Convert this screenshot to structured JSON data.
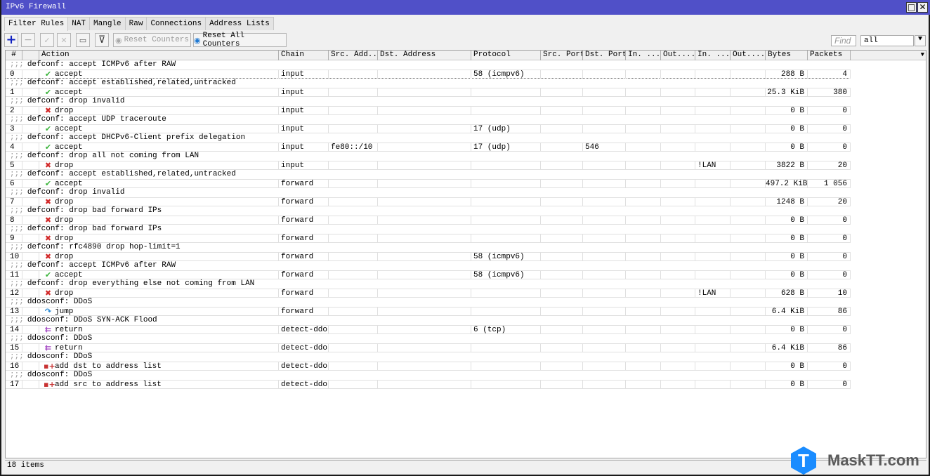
{
  "window": {
    "title": "IPv6 Firewall",
    "maximize_icon": "□",
    "close_icon": "✕"
  },
  "tabs": [
    {
      "label": "Filter Rules",
      "active": true
    },
    {
      "label": "NAT",
      "active": false
    },
    {
      "label": "Mangle",
      "active": false
    },
    {
      "label": "Raw",
      "active": false
    },
    {
      "label": "Connections",
      "active": false
    },
    {
      "label": "Address Lists",
      "active": false
    }
  ],
  "toolbar": {
    "add_icon": "+",
    "remove_icon": "−",
    "enable_icon": "✓",
    "disable_icon": "✕",
    "comment_icon": "▭",
    "filter_icon": "⊽",
    "reset_counters_label": "Reset Counters",
    "reset_all_counters_label": "Reset All Counters",
    "find_placeholder": "Find",
    "filter_value": "all",
    "filter_drop_icon": "⯆"
  },
  "table": {
    "columns": [
      "#",
      "",
      "Action",
      "Chain",
      "Src. Add...",
      "Dst. Address",
      "Protocol",
      "Src. Port",
      "Dst. Port",
      "In. ...",
      "Out....",
      "In. ...",
      "Out....",
      "Bytes",
      "Packets"
    ],
    "menu_icon": "▼",
    "rules": [
      {
        "comment": "defconf: accept ICMPv6 after RAW",
        "num": "0",
        "action": "accept",
        "action_type": "accept",
        "chain": "input",
        "src": "",
        "dst": "",
        "protocol": "58 (icmpv6)",
        "src_port": "",
        "dst_port": "",
        "in_iface": "",
        "out_iface": "",
        "in_list": "",
        "out_list": "",
        "bytes": "288 B",
        "packets": "4"
      },
      {
        "comment": "defconf: accept established,related,untracked",
        "num": "1",
        "action": "accept",
        "action_type": "accept",
        "chain": "input",
        "src": "",
        "dst": "",
        "protocol": "",
        "src_port": "",
        "dst_port": "",
        "in_iface": "",
        "out_iface": "",
        "in_list": "",
        "out_list": "",
        "bytes": "25.3 KiB",
        "packets": "380"
      },
      {
        "comment": "defconf: drop invalid",
        "num": "2",
        "action": "drop",
        "action_type": "drop",
        "chain": "input",
        "src": "",
        "dst": "",
        "protocol": "",
        "src_port": "",
        "dst_port": "",
        "in_iface": "",
        "out_iface": "",
        "in_list": "",
        "out_list": "",
        "bytes": "0 B",
        "packets": "0"
      },
      {
        "comment": "defconf: accept UDP traceroute",
        "num": "3",
        "action": "accept",
        "action_type": "accept",
        "chain": "input",
        "src": "",
        "dst": "",
        "protocol": "17 (udp)",
        "src_port": "",
        "dst_port": "",
        "in_iface": "",
        "out_iface": "",
        "in_list": "",
        "out_list": "",
        "bytes": "0 B",
        "packets": "0"
      },
      {
        "comment": "defconf: accept DHCPv6-Client prefix delegation",
        "num": "4",
        "action": "accept",
        "action_type": "accept",
        "chain": "input",
        "src": "fe80::/10",
        "dst": "",
        "protocol": "17 (udp)",
        "src_port": "",
        "dst_port": "546",
        "in_iface": "",
        "out_iface": "",
        "in_list": "",
        "out_list": "",
        "bytes": "0 B",
        "packets": "0"
      },
      {
        "comment": "defconf: drop all not coming from LAN",
        "num": "5",
        "action": "drop",
        "action_type": "drop",
        "chain": "input",
        "src": "",
        "dst": "",
        "protocol": "",
        "src_port": "",
        "dst_port": "",
        "in_iface": "",
        "out_iface": "",
        "in_list": "!LAN",
        "out_list": "",
        "bytes": "3822 B",
        "packets": "20"
      },
      {
        "comment": "defconf: accept established,related,untracked",
        "num": "6",
        "action": "accept",
        "action_type": "accept",
        "chain": "forward",
        "src": "",
        "dst": "",
        "protocol": "",
        "src_port": "",
        "dst_port": "",
        "in_iface": "",
        "out_iface": "",
        "in_list": "",
        "out_list": "",
        "bytes": "497.2 KiB",
        "packets": "1 056"
      },
      {
        "comment": "defconf: drop invalid",
        "num": "7",
        "action": "drop",
        "action_type": "drop",
        "chain": "forward",
        "src": "",
        "dst": "",
        "protocol": "",
        "src_port": "",
        "dst_port": "",
        "in_iface": "",
        "out_iface": "",
        "in_list": "",
        "out_list": "",
        "bytes": "1248 B",
        "packets": "20"
      },
      {
        "comment": "defconf: drop bad forward IPs",
        "num": "8",
        "action": "drop",
        "action_type": "drop",
        "chain": "forward",
        "src": "",
        "dst": "",
        "protocol": "",
        "src_port": "",
        "dst_port": "",
        "in_iface": "",
        "out_iface": "",
        "in_list": "",
        "out_list": "",
        "bytes": "0 B",
        "packets": "0"
      },
      {
        "comment": "defconf: drop bad forward IPs",
        "num": "9",
        "action": "drop",
        "action_type": "drop",
        "chain": "forward",
        "src": "",
        "dst": "",
        "protocol": "",
        "src_port": "",
        "dst_port": "",
        "in_iface": "",
        "out_iface": "",
        "in_list": "",
        "out_list": "",
        "bytes": "0 B",
        "packets": "0"
      },
      {
        "comment": "defconf: rfc4890 drop hop-limit=1",
        "num": "10",
        "action": "drop",
        "action_type": "drop",
        "chain": "forward",
        "src": "",
        "dst": "",
        "protocol": "58 (icmpv6)",
        "src_port": "",
        "dst_port": "",
        "in_iface": "",
        "out_iface": "",
        "in_list": "",
        "out_list": "",
        "bytes": "0 B",
        "packets": "0"
      },
      {
        "comment": "defconf: accept ICMPv6 after RAW",
        "num": "11",
        "action": "accept",
        "action_type": "accept",
        "chain": "forward",
        "src": "",
        "dst": "",
        "protocol": "58 (icmpv6)",
        "src_port": "",
        "dst_port": "",
        "in_iface": "",
        "out_iface": "",
        "in_list": "",
        "out_list": "",
        "bytes": "0 B",
        "packets": "0"
      },
      {
        "comment": "defconf: drop everything else not coming from LAN",
        "num": "12",
        "action": "drop",
        "action_type": "drop",
        "chain": "forward",
        "src": "",
        "dst": "",
        "protocol": "",
        "src_port": "",
        "dst_port": "",
        "in_iface": "",
        "out_iface": "",
        "in_list": "!LAN",
        "out_list": "",
        "bytes": "628 B",
        "packets": "10"
      },
      {
        "comment": "ddosconf: DDoS",
        "num": "13",
        "action": "jump",
        "action_type": "jump",
        "chain": "forward",
        "src": "",
        "dst": "",
        "protocol": "",
        "src_port": "",
        "dst_port": "",
        "in_iface": "",
        "out_iface": "",
        "in_list": "",
        "out_list": "",
        "bytes": "6.4 KiB",
        "packets": "86"
      },
      {
        "comment": "ddosconf: DDoS SYN-ACK Flood",
        "num": "14",
        "action": "return",
        "action_type": "return",
        "chain": "detect-ddos",
        "src": "",
        "dst": "",
        "protocol": "6 (tcp)",
        "src_port": "",
        "dst_port": "",
        "in_iface": "",
        "out_iface": "",
        "in_list": "",
        "out_list": "",
        "bytes": "0 B",
        "packets": "0"
      },
      {
        "comment": "ddosconf: DDoS",
        "num": "15",
        "action": "return",
        "action_type": "return",
        "chain": "detect-ddos",
        "src": "",
        "dst": "",
        "protocol": "",
        "src_port": "",
        "dst_port": "",
        "in_iface": "",
        "out_iface": "",
        "in_list": "",
        "out_list": "",
        "bytes": "6.4 KiB",
        "packets": "86"
      },
      {
        "comment": "ddosconf: DDoS",
        "num": "16",
        "action": "add dst to address list",
        "action_type": "add-list",
        "chain": "detect-ddos",
        "src": "",
        "dst": "",
        "protocol": "",
        "src_port": "",
        "dst_port": "",
        "in_iface": "",
        "out_iface": "",
        "in_list": "",
        "out_list": "",
        "bytes": "0 B",
        "packets": "0"
      },
      {
        "comment": "ddosconf: DDoS",
        "num": "17",
        "action": "add src to address list",
        "action_type": "add-list",
        "chain": "detect-ddos",
        "src": "",
        "dst": "",
        "protocol": "",
        "src_port": "",
        "dst_port": "",
        "in_iface": "",
        "out_iface": "",
        "in_list": "",
        "out_list": "",
        "bytes": "0 B",
        "packets": "0"
      }
    ]
  },
  "status": {
    "item_count": "18 items"
  },
  "watermark": {
    "logo_letter": "T",
    "text": "MaskTT.com"
  },
  "icons": {
    "accept": {
      "glyph": "✔",
      "color": "#3cb43c"
    },
    "drop": {
      "glyph": "✖",
      "color": "#d22828"
    },
    "jump": {
      "glyph": "↷",
      "color": "#2a8ad4"
    },
    "return": {
      "glyph": "⇇",
      "color": "#a040c0"
    },
    "add-list": {
      "glyph": "▪+",
      "color": "#c83232"
    }
  },
  "comment_prefix": ";;;"
}
